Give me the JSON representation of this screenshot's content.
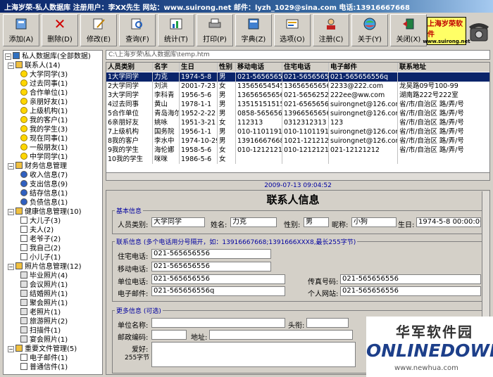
{
  "window": {
    "title": "上海岁荣-私人数据库   注册用户：李XX先生   网站：www.suirong.net  邮件：lyzh_1029@sina.com  电话:13916667668"
  },
  "toolbar": [
    {
      "label": "添加(A)",
      "icon": "add-icon"
    },
    {
      "label": "删除(D)",
      "icon": "delete-icon"
    },
    {
      "label": "修改(E)",
      "icon": "edit-icon"
    },
    {
      "label": "查询(F)",
      "icon": "search-icon"
    },
    {
      "label": "统计(T)",
      "icon": "stats-icon"
    },
    {
      "label": "打印(P)",
      "icon": "print-icon"
    },
    {
      "label": "字典(Z)",
      "icon": "dictionary-icon"
    },
    {
      "label": "选项(O)",
      "icon": "options-icon"
    },
    {
      "label": "注册(C)",
      "icon": "register-icon"
    },
    {
      "label": "关于(Y)",
      "icon": "about-icon"
    },
    {
      "label": "关闭(X)",
      "icon": "close-icon"
    }
  ],
  "logo": {
    "text": "上海岁荣软件",
    "sub": "www.suirong.net"
  },
  "tree": {
    "root": "私人数据库(全部数据)",
    "nodes": [
      {
        "label": "联系人(14)",
        "level": 1,
        "kind": "folder"
      },
      {
        "label": "大学同学(3)",
        "level": 2,
        "kind": "face"
      },
      {
        "label": "过去同事(1)",
        "level": 2,
        "kind": "face"
      },
      {
        "label": "合作单位(1)",
        "level": 2,
        "kind": "face"
      },
      {
        "label": "亲朋好友(1)",
        "level": 2,
        "kind": "face"
      },
      {
        "label": "上级机构(1)",
        "level": 2,
        "kind": "face"
      },
      {
        "label": "我的客户(1)",
        "level": 2,
        "kind": "face"
      },
      {
        "label": "我的学生(3)",
        "level": 2,
        "kind": "face"
      },
      {
        "label": "现在同事(1)",
        "level": 2,
        "kind": "face"
      },
      {
        "label": "一般朋友(1)",
        "level": 2,
        "kind": "face"
      },
      {
        "label": "中学同学(1)",
        "level": 2,
        "kind": "face"
      },
      {
        "label": "财务信息管理",
        "level": 1,
        "kind": "folder"
      },
      {
        "label": "收入信息(7)",
        "level": 2,
        "kind": "info"
      },
      {
        "label": "支出信息(9)",
        "level": 2,
        "kind": "info"
      },
      {
        "label": "结存信息(1)",
        "level": 2,
        "kind": "info"
      },
      {
        "label": "负债信息(1)",
        "level": 2,
        "kind": "info"
      },
      {
        "label": "健康信息管理(10)",
        "level": 1,
        "kind": "folder"
      },
      {
        "label": "大儿子(3)",
        "level": 2,
        "kind": "doc"
      },
      {
        "label": "夫人(2)",
        "level": 2,
        "kind": "doc"
      },
      {
        "label": "老爷子(2)",
        "level": 2,
        "kind": "doc"
      },
      {
        "label": "我自己(2)",
        "level": 2,
        "kind": "doc"
      },
      {
        "label": "小儿子(1)",
        "level": 2,
        "kind": "doc"
      },
      {
        "label": "照片信息管理(12)",
        "level": 1,
        "kind": "folder"
      },
      {
        "label": "毕业照片(4)",
        "level": 2,
        "kind": "bell"
      },
      {
        "label": "会议照片(1)",
        "level": 2,
        "kind": "bell"
      },
      {
        "label": "结婚照片(1)",
        "level": 2,
        "kind": "bell"
      },
      {
        "label": "聚会照片(1)",
        "level": 2,
        "kind": "bell"
      },
      {
        "label": "老照片(1)",
        "level": 2,
        "kind": "bell"
      },
      {
        "label": "旅游照片(2)",
        "level": 2,
        "kind": "bell"
      },
      {
        "label": "扫描件(1)",
        "level": 2,
        "kind": "bell"
      },
      {
        "label": "宴会照片(1)",
        "level": 2,
        "kind": "bell"
      },
      {
        "label": "重要文件管理(5)",
        "level": 1,
        "kind": "folder"
      },
      {
        "label": "电子邮件(1)",
        "level": 2,
        "kind": "doc"
      },
      {
        "label": "普通信件(1)",
        "level": 2,
        "kind": "doc"
      }
    ]
  },
  "path": "C:\\上海岁荣\\私人数据库\\temp.htm",
  "table": {
    "headers": [
      "人员类别",
      "名字",
      "生日",
      "性别",
      "移动电话",
      "住宅电话",
      "电子邮件",
      "联系地址"
    ],
    "rows": [
      [
        "1大学同学",
        "力克",
        "1974-5-8",
        "男",
        "021-565656556",
        "021-565656556",
        "021-565656556q",
        ""
      ],
      [
        "2大学同学",
        "刘洪",
        "2001-7-23",
        "女",
        "13565654545",
        "13656565656",
        "2233@222.com",
        "龙吴路09号100-99"
      ],
      [
        "3大学同学",
        "李科青",
        "1956-5-6",
        "男",
        "13656565656",
        "021-56562525",
        "222ee@ww.com",
        "湖南路222号222室"
      ],
      [
        "4过去同事",
        "黄山",
        "1978-1-1",
        "男",
        "13515151515",
        "021-65656565",
        "suirongnet@126.com",
        "省/市/自治区 路/弄/号"
      ],
      [
        "5合作单位",
        "青岛海尔",
        "1952-2-22",
        "男",
        "0858-5656565",
        "13966565656",
        "suirongnet@126.com",
        "省/市/自治区 路/弄/号"
      ],
      [
        "6亲朋好友",
        "姚咏",
        "1951-3-21",
        "女",
        "112313",
        "0312312313",
        "123",
        "省/市/自治区 路/弄/号"
      ],
      [
        "7上级机构",
        "国务院",
        "1956-1-1",
        "男",
        "010-1101191121",
        "010-1101191121",
        "suirongnet@126.com",
        "省/市/自治区 路/弄/号"
      ],
      [
        "8我的客户",
        "李水中",
        "1974-10-29",
        "男",
        "13916667668,",
        "1021-12121212,",
        "suirongnet@126.com",
        "省/市/自治区 路/弄/号"
      ],
      [
        "9我的学生",
        "海伦娜",
        "1958-5-6",
        "女",
        "010-12121212",
        "010-12121212",
        "021-12121212",
        "省/市/自治区 路/弄/号"
      ],
      [
        "10我的学生",
        "咪咪",
        "1986-5-6",
        "女",
        "",
        "",
        "",
        ""
      ]
    ]
  },
  "datetime": "2009-07-13  09:04:52",
  "form": {
    "title": "联系人信息",
    "basic": {
      "group": "基本信息",
      "category_label": "人员类别:",
      "category": "大学同学",
      "name_label": "姓名:",
      "name": "力克",
      "gender_label": "性别:",
      "gender": "男",
      "nick_label": "昵称:",
      "nick": "小狗",
      "birth_label": "生日:",
      "birth": "1974-5-8  00:00:00"
    },
    "contact": {
      "group": "联系信息 (多个电话用分号隔开，如：13916667668;1391666XXX8,最长255字节)",
      "home_label": "住宅电话:",
      "home": "021-565656556",
      "mobile_label": "移动电话:",
      "mobile": "021-565656556",
      "work_label": "单位电话:",
      "work": "021-565656556",
      "fax_label": "传真号码:",
      "fax": "021-565656556",
      "email_label": "电子邮件:",
      "email": "021-565656556q",
      "web_label": "个人网站:",
      "web": "021-565656556"
    },
    "more": {
      "group": "更多信息 (可选)",
      "unit_label": "单位名称:",
      "unit": "",
      "title_label": "头衔:",
      "title": "",
      "zip_label": "邮政编码:",
      "zip": "",
      "addr_label": "地址:",
      "addr": "",
      "hobby_label": "爱好:",
      "hobby_sub": "255字节",
      "hobby": ""
    }
  },
  "watermark": {
    "cn": "华军软件园",
    "en": "ONLINEDOWN",
    "url": "www.newhua.com"
  }
}
